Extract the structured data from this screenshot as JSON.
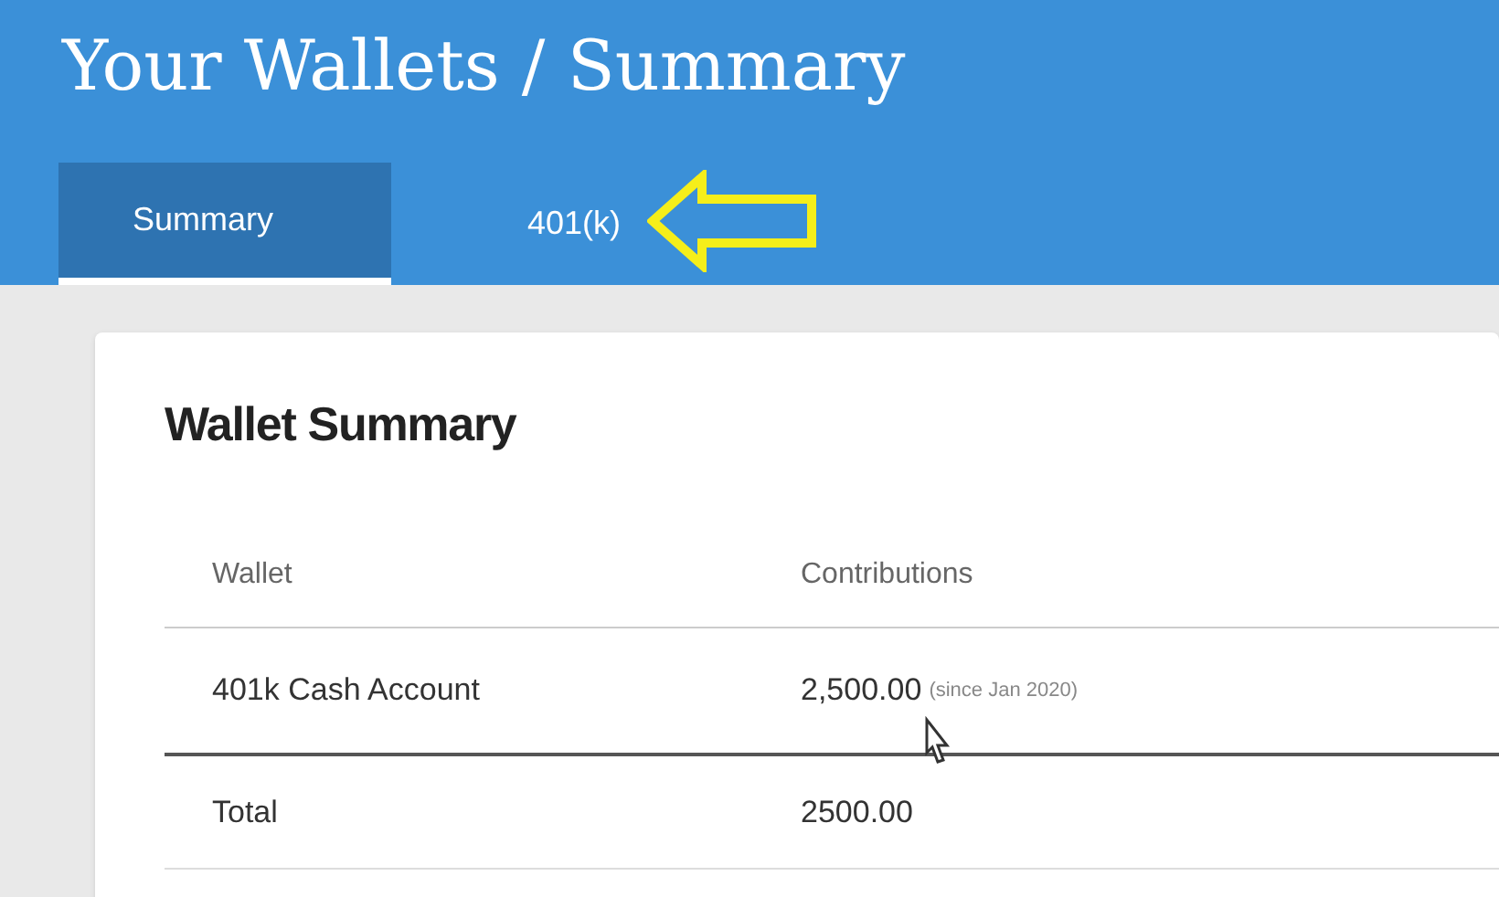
{
  "header": {
    "title": "Your Wallets / Summary"
  },
  "tabs": [
    {
      "label": "Summary",
      "selected": true
    },
    {
      "label": "401(k)",
      "selected": false
    }
  ],
  "card": {
    "title": "Wallet Summary",
    "columns": [
      "Wallet",
      "Contributions"
    ],
    "rows": [
      {
        "wallet": "401k Cash Account",
        "contributions": "2,500.00",
        "note": "(since Jan 2020)"
      }
    ],
    "total": {
      "label": "Total",
      "value": "2500.00"
    }
  }
}
